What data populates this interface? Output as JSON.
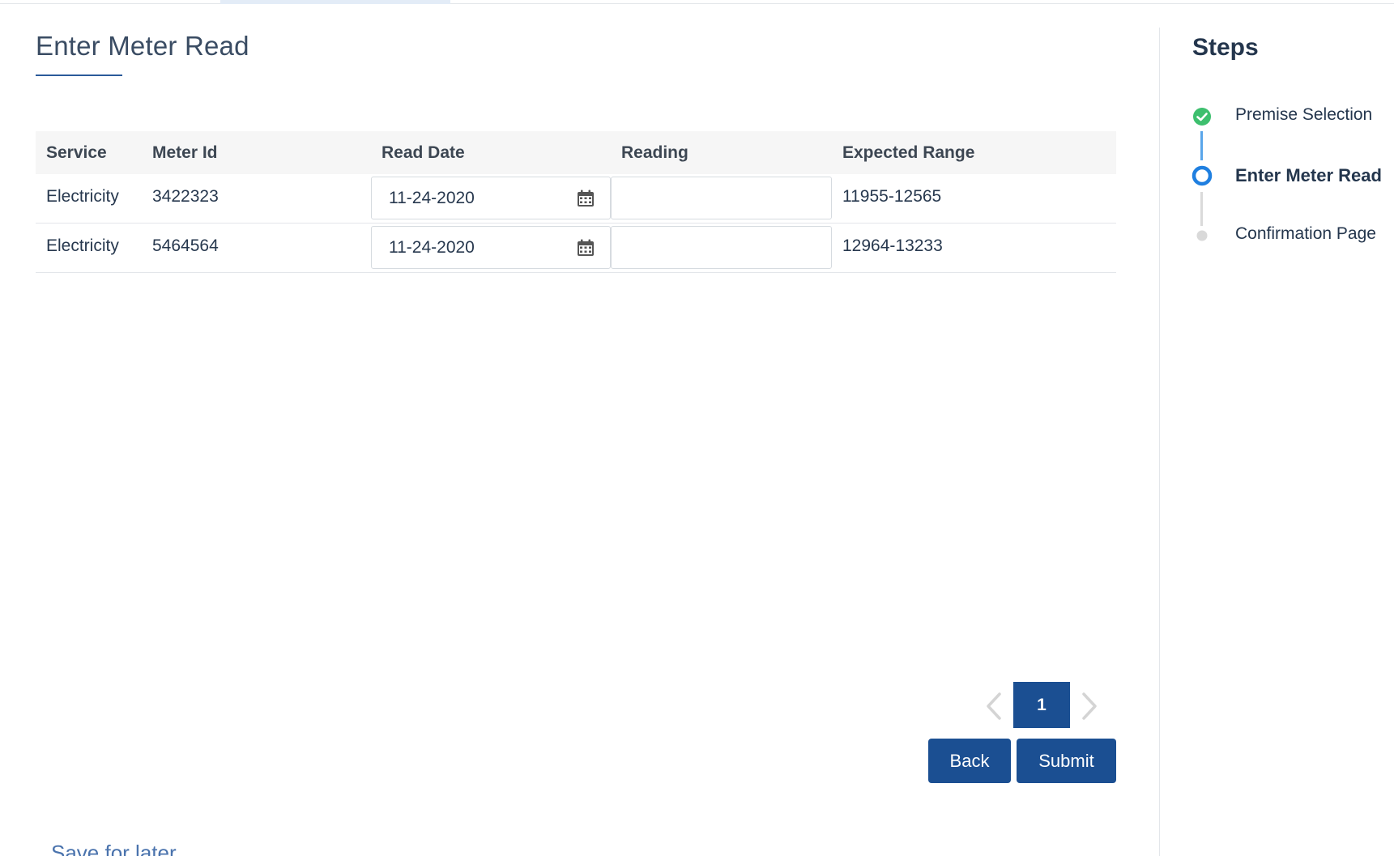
{
  "page": {
    "title": "Enter Meter Read",
    "save_later": "Save for later"
  },
  "table": {
    "headers": {
      "service": "Service",
      "meter_id": "Meter Id",
      "read_date": "Read Date",
      "reading": "Reading",
      "expected_range": "Expected Range"
    },
    "rows": [
      {
        "service": "Electricity",
        "meter_id": "3422323",
        "read_date": "11-24-2020",
        "reading": "",
        "expected_range": "11955-12565"
      },
      {
        "service": "Electricity",
        "meter_id": "5464564",
        "read_date": "11-24-2020",
        "reading": "",
        "expected_range": "12964-13233"
      }
    ]
  },
  "pagination": {
    "current_page": "1",
    "prev_icon": "chevron-left-icon",
    "next_icon": "chevron-right-icon"
  },
  "actions": {
    "back_label": "Back",
    "submit_label": "Submit"
  },
  "steps": {
    "title": "Steps",
    "items": [
      {
        "label": "Premise Selection",
        "status": "complete"
      },
      {
        "label": "Enter Meter Read",
        "status": "active"
      },
      {
        "label": "Confirmation Page",
        "status": "pending"
      }
    ]
  },
  "colors": {
    "primary": "#1b4f92",
    "complete": "#3dbf6e",
    "active": "#1f7fe0",
    "pending": "#d9d9d9"
  }
}
